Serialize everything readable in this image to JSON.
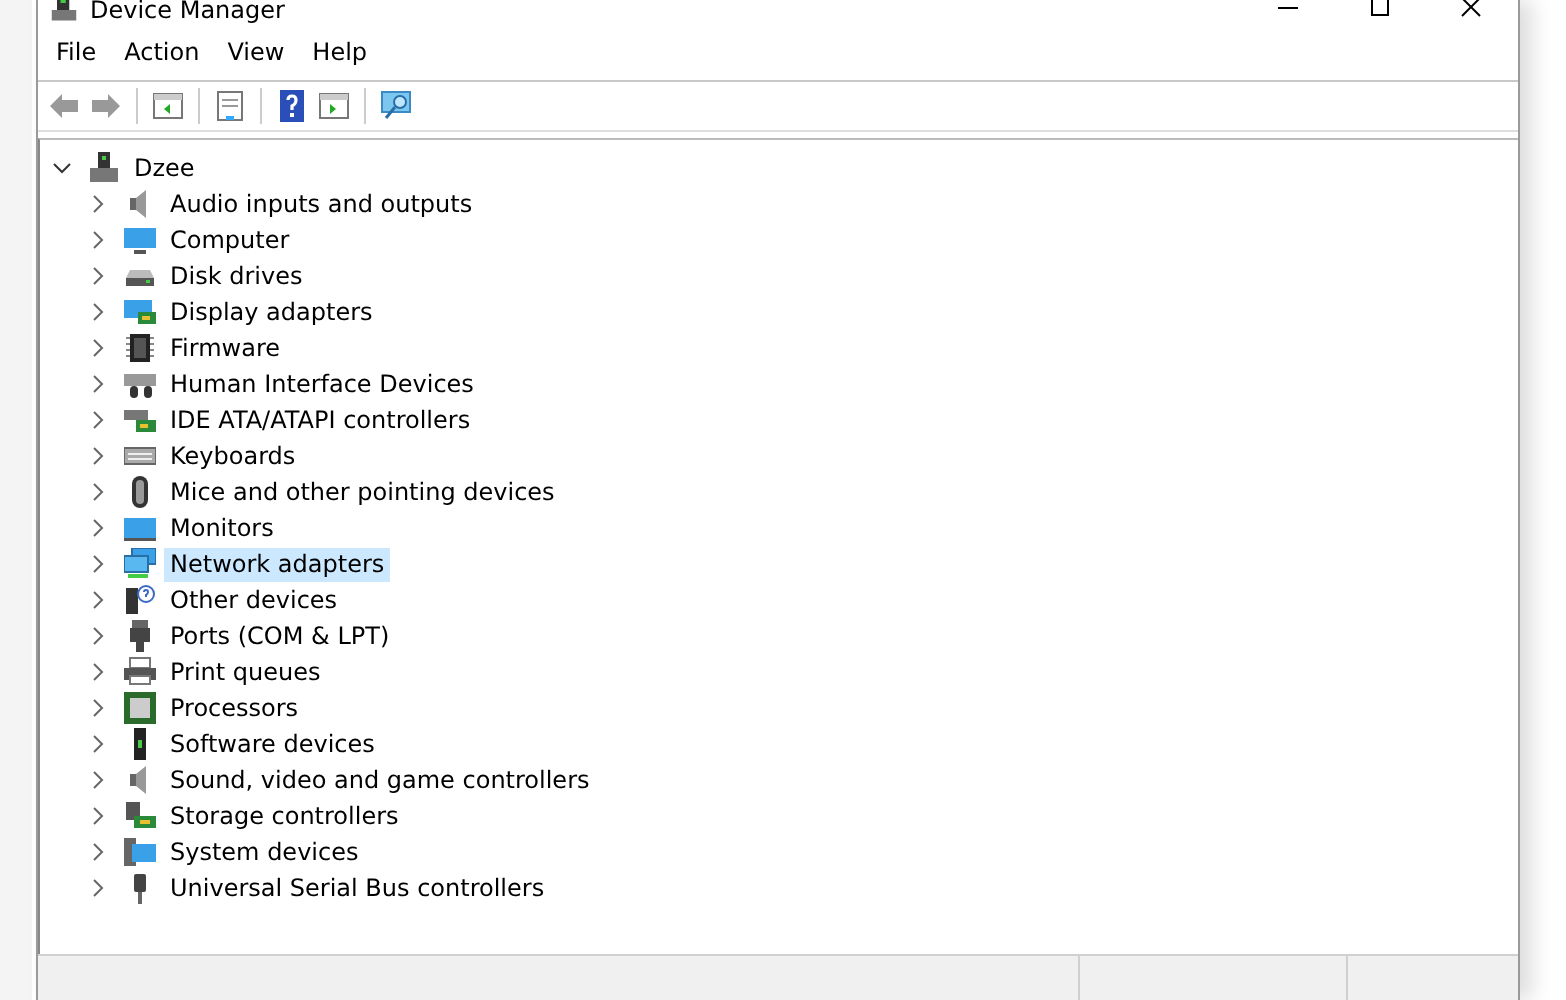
{
  "window": {
    "title": "Device Manager"
  },
  "menu": [
    "File",
    "Action",
    "View",
    "Help"
  ],
  "tree": {
    "label": "Dzee",
    "expanded": true,
    "children": [
      {
        "label": "Audio inputs and outputs",
        "expanded": false,
        "selected": false
      },
      {
        "label": "Computer",
        "expanded": false,
        "selected": false
      },
      {
        "label": "Disk drives",
        "expanded": false,
        "selected": false
      },
      {
        "label": "Display adapters",
        "expanded": false,
        "selected": false
      },
      {
        "label": "Firmware",
        "expanded": false,
        "selected": false
      },
      {
        "label": "Human Interface Devices",
        "expanded": false,
        "selected": false
      },
      {
        "label": "IDE ATA/ATAPI controllers",
        "expanded": false,
        "selected": false
      },
      {
        "label": "Keyboards",
        "expanded": false,
        "selected": false
      },
      {
        "label": "Mice and other pointing devices",
        "expanded": false,
        "selected": false
      },
      {
        "label": "Monitors",
        "expanded": false,
        "selected": false
      },
      {
        "label": "Network adapters",
        "expanded": false,
        "selected": true
      },
      {
        "label": "Other devices",
        "expanded": false,
        "selected": false
      },
      {
        "label": "Ports (COM & LPT)",
        "expanded": false,
        "selected": false
      },
      {
        "label": "Print queues",
        "expanded": false,
        "selected": false
      },
      {
        "label": "Processors",
        "expanded": false,
        "selected": false
      },
      {
        "label": "Software devices",
        "expanded": false,
        "selected": false
      },
      {
        "label": "Sound, video and game controllers",
        "expanded": false,
        "selected": false
      },
      {
        "label": "Storage controllers",
        "expanded": false,
        "selected": false
      },
      {
        "label": "System devices",
        "expanded": false,
        "selected": false
      },
      {
        "label": "Universal Serial Bus controllers",
        "expanded": false,
        "selected": false
      }
    ]
  }
}
